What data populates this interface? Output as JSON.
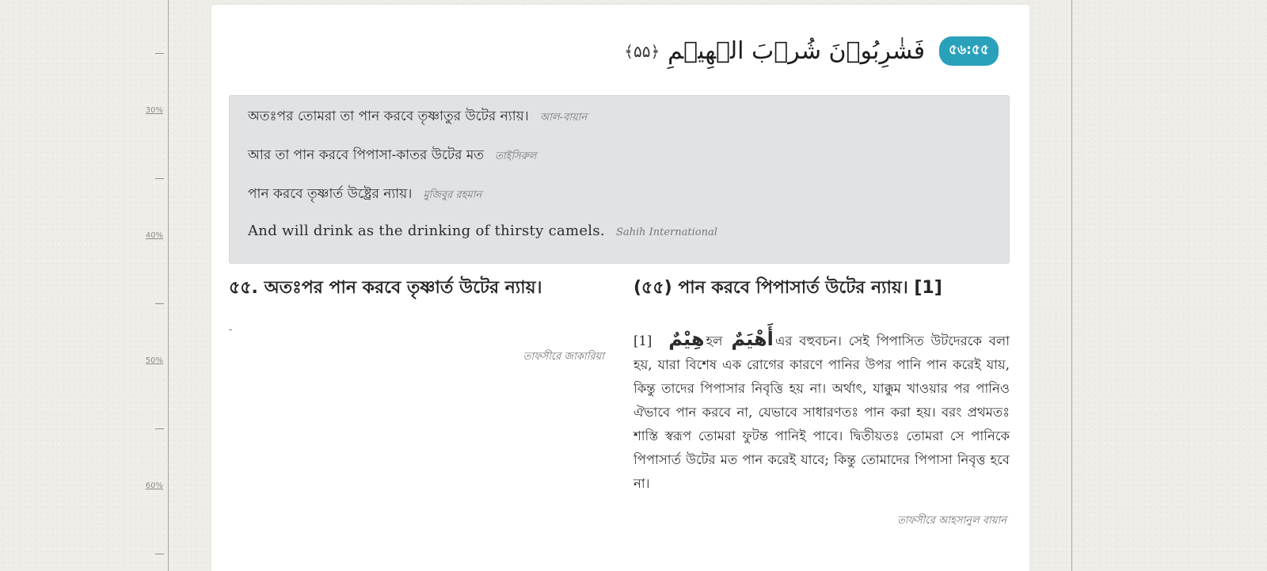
{
  "ruler": {
    "ticks": [
      {
        "label": ""
      },
      {
        "label": "30%"
      },
      {
        "label": ""
      },
      {
        "label": "40%"
      },
      {
        "label": ""
      },
      {
        "label": "50%"
      },
      {
        "label": ""
      },
      {
        "label": "60%"
      },
      {
        "label": ""
      }
    ]
  },
  "ayah": {
    "number": "৫৬:৫৫",
    "arabic": "فَشٰرِبُوۡنَ شُرۡبَ الۡهِیۡمِ",
    "marker": "﴿۵۵﴾"
  },
  "translations": [
    {
      "text": "অতঃপর তোমরা তা পান করবে তৃষ্ণাতুর উটের ন্যায়।",
      "source": "আল-বায়ান"
    },
    {
      "text": "আর তা পান করবে পিপাসা-কাতর উটের মত",
      "source": "তাইসিরুল"
    },
    {
      "text": "পান করবে তৃষ্ণার্ত উষ্ট্রের ন্যায়।",
      "source": "মুজিবুর রহমান"
    },
    {
      "text": "And will drink as the drinking of thirsty camels.",
      "source": "Sahih International"
    }
  ],
  "tafsir_left": {
    "title": "৫৫. অতঃপর পান করবে তৃষ্ণার্ত উটের ন্যায়।",
    "body": "-",
    "source": "তাফসীরে জাকারিয়া"
  },
  "tafsir_right": {
    "title": "(৫৫) পান করবে পিপাসার্ত উটের ন্যায়। [1]",
    "footnote": "[1]",
    "arabic_word": "هِيْمٌ",
    "word_link": "হল",
    "arabic_root": "أَهْيَمٌ",
    "body": "এর বহুবচন। সেই পিপাসিত উটদেরকে বলা হয়, যারা বিশেষ এক রোগের কারণে পানির উপর পানি পান করেই যায়, কিন্তু তাদের পিপাসার নিবৃত্তি হয় না। অর্থাৎ, যাক্কুম খাওয়ার পর পানিও ঐভাবে পান করবে না, যেভাবে সাধারণতঃ পান করা হয়। বরং প্রথমতঃ শাস্তি স্বরূপ তোমরা ফুটন্ত পানিই পাবে। দ্বিতীয়তঃ তোমরা সে পানিকে পিপাসার্ত উটের মত পান করেই যাবে; কিন্তু তোমাদের পিপাসা নিবৃত্ত হবে না।",
    "source": "তাফসীরে আহসানুল বায়ান"
  },
  "colors": {
    "badge": "#2aa1bb",
    "translation_box": "#e1e2e4",
    "page_background": "#eeede8"
  }
}
